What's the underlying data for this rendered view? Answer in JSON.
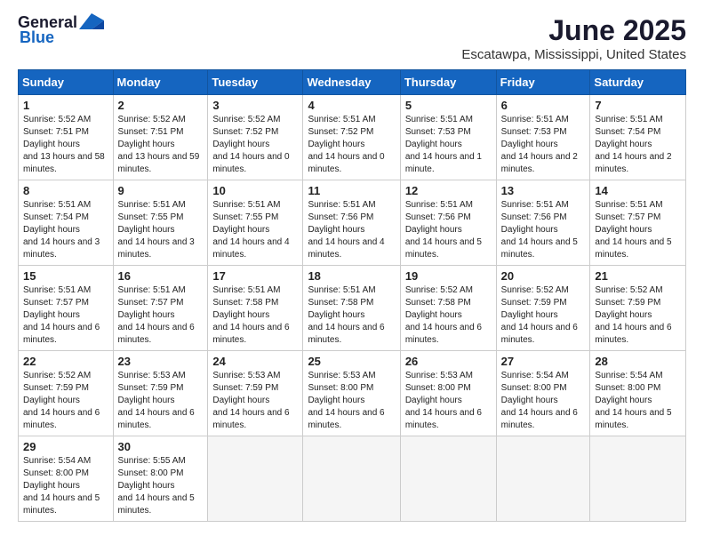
{
  "logo": {
    "line1": "General",
    "line2": "Blue"
  },
  "title": "June 2025",
  "subtitle": "Escatawpa, Mississippi, United States",
  "weekdays": [
    "Sunday",
    "Monday",
    "Tuesday",
    "Wednesday",
    "Thursday",
    "Friday",
    "Saturday"
  ],
  "weeks": [
    [
      {
        "day": "1",
        "sr": "5:52 AM",
        "ss": "7:51 PM",
        "dh": "13 hours and 58 minutes."
      },
      {
        "day": "2",
        "sr": "5:52 AM",
        "ss": "7:51 PM",
        "dh": "13 hours and 59 minutes."
      },
      {
        "day": "3",
        "sr": "5:52 AM",
        "ss": "7:52 PM",
        "dh": "14 hours and 0 minutes."
      },
      {
        "day": "4",
        "sr": "5:51 AM",
        "ss": "7:52 PM",
        "dh": "14 hours and 0 minutes."
      },
      {
        "day": "5",
        "sr": "5:51 AM",
        "ss": "7:53 PM",
        "dh": "14 hours and 1 minute."
      },
      {
        "day": "6",
        "sr": "5:51 AM",
        "ss": "7:53 PM",
        "dh": "14 hours and 2 minutes."
      },
      {
        "day": "7",
        "sr": "5:51 AM",
        "ss": "7:54 PM",
        "dh": "14 hours and 2 minutes."
      }
    ],
    [
      {
        "day": "8",
        "sr": "5:51 AM",
        "ss": "7:54 PM",
        "dh": "14 hours and 3 minutes."
      },
      {
        "day": "9",
        "sr": "5:51 AM",
        "ss": "7:55 PM",
        "dh": "14 hours and 3 minutes."
      },
      {
        "day": "10",
        "sr": "5:51 AM",
        "ss": "7:55 PM",
        "dh": "14 hours and 4 minutes."
      },
      {
        "day": "11",
        "sr": "5:51 AM",
        "ss": "7:56 PM",
        "dh": "14 hours and 4 minutes."
      },
      {
        "day": "12",
        "sr": "5:51 AM",
        "ss": "7:56 PM",
        "dh": "14 hours and 5 minutes."
      },
      {
        "day": "13",
        "sr": "5:51 AM",
        "ss": "7:56 PM",
        "dh": "14 hours and 5 minutes."
      },
      {
        "day": "14",
        "sr": "5:51 AM",
        "ss": "7:57 PM",
        "dh": "14 hours and 5 minutes."
      }
    ],
    [
      {
        "day": "15",
        "sr": "5:51 AM",
        "ss": "7:57 PM",
        "dh": "14 hours and 6 minutes."
      },
      {
        "day": "16",
        "sr": "5:51 AM",
        "ss": "7:57 PM",
        "dh": "14 hours and 6 minutes."
      },
      {
        "day": "17",
        "sr": "5:51 AM",
        "ss": "7:58 PM",
        "dh": "14 hours and 6 minutes."
      },
      {
        "day": "18",
        "sr": "5:51 AM",
        "ss": "7:58 PM",
        "dh": "14 hours and 6 minutes."
      },
      {
        "day": "19",
        "sr": "5:52 AM",
        "ss": "7:58 PM",
        "dh": "14 hours and 6 minutes."
      },
      {
        "day": "20",
        "sr": "5:52 AM",
        "ss": "7:59 PM",
        "dh": "14 hours and 6 minutes."
      },
      {
        "day": "21",
        "sr": "5:52 AM",
        "ss": "7:59 PM",
        "dh": "14 hours and 6 minutes."
      }
    ],
    [
      {
        "day": "22",
        "sr": "5:52 AM",
        "ss": "7:59 PM",
        "dh": "14 hours and 6 minutes."
      },
      {
        "day": "23",
        "sr": "5:53 AM",
        "ss": "7:59 PM",
        "dh": "14 hours and 6 minutes."
      },
      {
        "day": "24",
        "sr": "5:53 AM",
        "ss": "7:59 PM",
        "dh": "14 hours and 6 minutes."
      },
      {
        "day": "25",
        "sr": "5:53 AM",
        "ss": "8:00 PM",
        "dh": "14 hours and 6 minutes."
      },
      {
        "day": "26",
        "sr": "5:53 AM",
        "ss": "8:00 PM",
        "dh": "14 hours and 6 minutes."
      },
      {
        "day": "27",
        "sr": "5:54 AM",
        "ss": "8:00 PM",
        "dh": "14 hours and 6 minutes."
      },
      {
        "day": "28",
        "sr": "5:54 AM",
        "ss": "8:00 PM",
        "dh": "14 hours and 5 minutes."
      }
    ],
    [
      {
        "day": "29",
        "sr": "5:54 AM",
        "ss": "8:00 PM",
        "dh": "14 hours and 5 minutes."
      },
      {
        "day": "30",
        "sr": "5:55 AM",
        "ss": "8:00 PM",
        "dh": "14 hours and 5 minutes."
      },
      null,
      null,
      null,
      null,
      null
    ]
  ]
}
